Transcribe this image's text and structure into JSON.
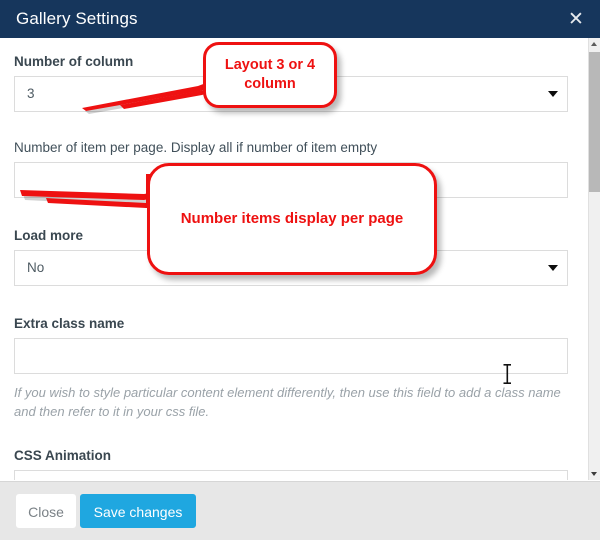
{
  "window": {
    "title": "Gallery Settings",
    "close_icon": "close-x-icon",
    "header_color": "#16365c"
  },
  "form": {
    "fields": [
      {
        "id": "number-of-column",
        "label": "Number of column",
        "type": "select",
        "value": "3",
        "caret": "chevron-down-icon"
      },
      {
        "id": "number-of-item-per-page",
        "label": "Number of item per page. Display all if number of item empty",
        "type": "text",
        "value": "",
        "placeholder": ""
      },
      {
        "id": "load-more",
        "label": "Load more",
        "type": "select",
        "value": "No",
        "caret": "chevron-down-icon"
      },
      {
        "id": "extra-class-name",
        "label": "Extra class name",
        "type": "text",
        "value": "",
        "placeholder": "",
        "helper": "If you wish to style particular content element differently, then use this field to add a class name and then refer to it in your css file."
      },
      {
        "id": "css-animation",
        "label": "CSS Animation",
        "type": "select",
        "value": ""
      }
    ]
  },
  "footer": {
    "close_label": "Close",
    "save_label": "Save changes",
    "save_color": "#1fa7e0"
  },
  "scrollbar": {
    "up_icon": "scroll-up-arrow-icon",
    "down_icon": "scroll-down-arrow-icon"
  },
  "annotations": {
    "color": "#ee1111",
    "callouts": [
      {
        "id": "callout-layout",
        "text": "Layout 3 or 4 column"
      },
      {
        "id": "callout-items-per-page",
        "text": "Number items display per page"
      }
    ]
  },
  "cursor": {
    "type": "text-ibeam-cursor"
  }
}
